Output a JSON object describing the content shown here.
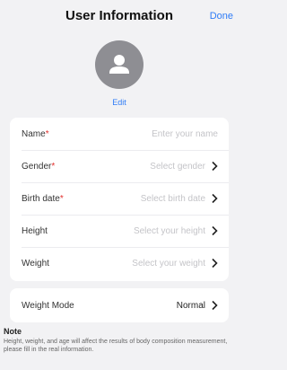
{
  "header": {
    "title": "User Information",
    "done_label": "Done"
  },
  "profile": {
    "edit_label": "Edit"
  },
  "fields": [
    {
      "label": "Name",
      "required_mark": "*",
      "placeholder": "Enter your name"
    },
    {
      "label": "Gender",
      "required_mark": "*",
      "placeholder": "Select gender"
    },
    {
      "label": "Birth date",
      "required_mark": "*",
      "placeholder": "Select birth date"
    },
    {
      "label": "Height",
      "placeholder": "Select your height"
    },
    {
      "label": "Weight",
      "placeholder": "Select your weight"
    }
  ],
  "weight_mode": {
    "label": "Weight Mode",
    "value": "Normal"
  },
  "note": {
    "title": "Note",
    "text": "Height, weight, and age will affect the results of body composition measurement, please fill in the real information."
  },
  "colors": {
    "accent": "#2f7cf6",
    "required": "#e2302d",
    "avatar": "#8e8e93"
  }
}
